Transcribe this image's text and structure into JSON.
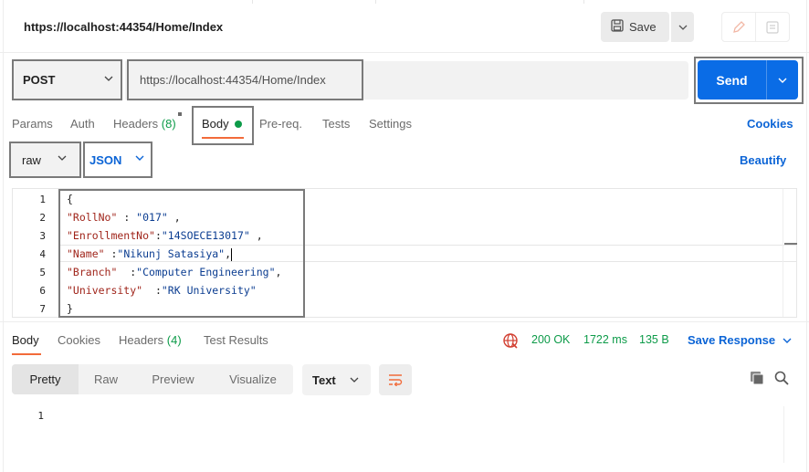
{
  "request": {
    "title": "https://localhost:44354/Home/Index",
    "save_label": "Save",
    "method": "POST",
    "url": "https://localhost:44354/Home/Index",
    "send_label": "Send"
  },
  "request_tabs": [
    {
      "label": "Params"
    },
    {
      "label": "Auth"
    },
    {
      "label": "Headers",
      "count": "(8)"
    },
    {
      "label": "Body"
    },
    {
      "label": "Pre-req."
    },
    {
      "label": "Tests"
    },
    {
      "label": "Settings"
    }
  ],
  "cookies_label": "Cookies",
  "body_mode": "raw",
  "body_language": "JSON",
  "beautify_label": "Beautify",
  "editor": {
    "line_numbers": [
      "1",
      "2",
      "3",
      "4",
      "5",
      "6",
      "7"
    ],
    "lines": [
      {
        "punct_open": "{"
      },
      {
        "key": "\"RollNo\"",
        "sep": " : ",
        "value": "\"017\"",
        "end": " ,"
      },
      {
        "key": "\"EnrollmentNo\"",
        "sep": ":",
        "value": "\"14SOECE13017\"",
        "end": " ,"
      },
      {
        "key": "\"Name\"",
        "sep": " :",
        "value": "\"Nikunj Satasiya\"",
        "end": ","
      },
      {
        "key": "\"Branch\"",
        "sep": "  :",
        "value": "\"Computer Engineering\"",
        "end": ","
      },
      {
        "key": "\"University\"",
        "sep": "  :",
        "value": "\"RK University\"",
        "end": ""
      },
      {
        "punct_close": "}"
      }
    ]
  },
  "response": {
    "tabs": [
      {
        "label": "Body"
      },
      {
        "label": "Cookies"
      },
      {
        "label": "Headers",
        "count": "(4)"
      },
      {
        "label": "Test Results"
      }
    ],
    "status": "200 OK",
    "time": "1722 ms",
    "size": "135 B",
    "save_response_label": "Save Response",
    "view_modes": [
      "Pretty",
      "Raw",
      "Preview",
      "Visualize"
    ],
    "format": "Text",
    "line_numbers": [
      "1"
    ]
  },
  "colors": {
    "accent_blue": "#0a6ce6",
    "tab_underline": "#f26b3a",
    "success_green": "#0d9b49"
  }
}
